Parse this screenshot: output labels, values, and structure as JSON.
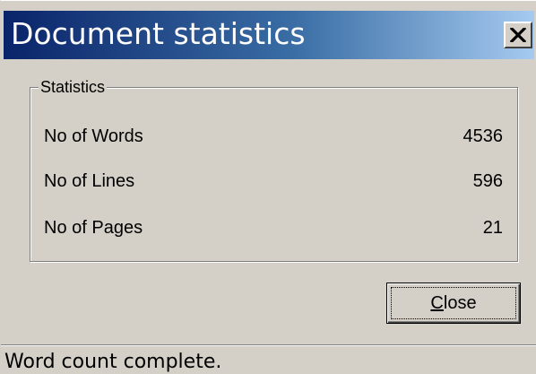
{
  "window": {
    "title": "Document statistics"
  },
  "titlebar_buttons": {
    "close_icon": "close-x-icon"
  },
  "statistics": {
    "group_label": "Statistics",
    "rows": [
      {
        "label": "No of Words",
        "value": "4536"
      },
      {
        "label": "No of Lines",
        "value": "596"
      },
      {
        "label": "No of Pages",
        "value": "21"
      }
    ]
  },
  "buttons": {
    "close_mnemonic": "C",
    "close_rest": "lose"
  },
  "status": {
    "text": "Word count complete."
  },
  "colors": {
    "face": "#d4d0c8",
    "title_start": "#0a246a",
    "title_end": "#a6caf0"
  }
}
